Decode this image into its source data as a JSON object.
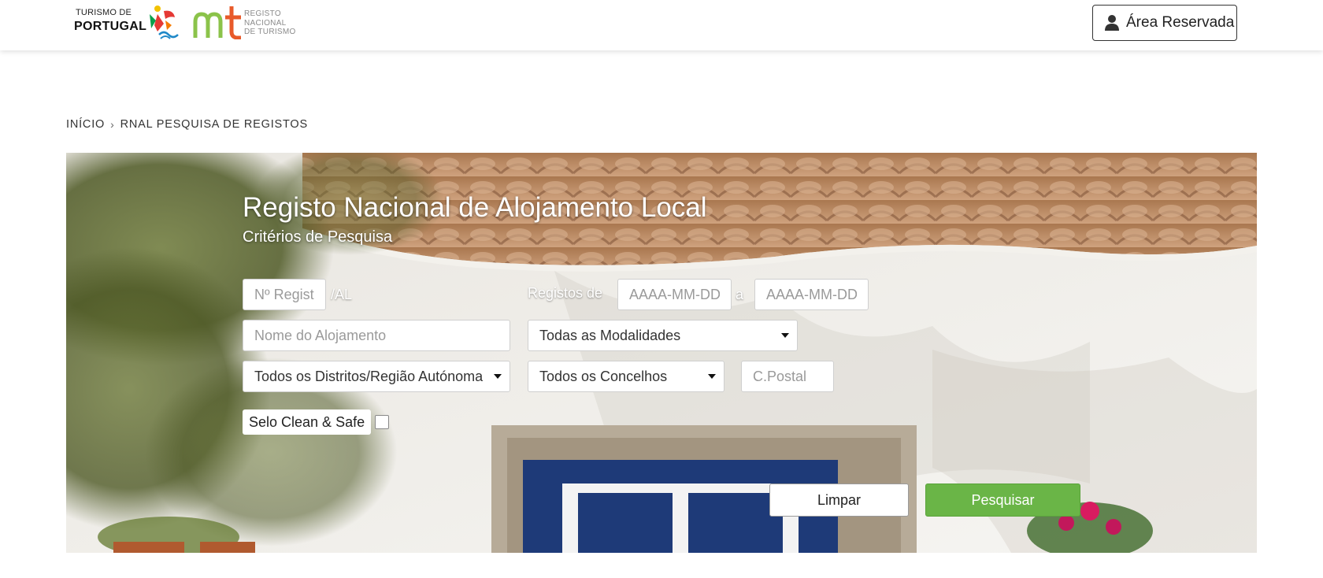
{
  "header": {
    "logo_tp_top": "TURISMO DE",
    "logo_tp_bottom": "PORTUGAL",
    "logo_rnt_line1": "REGISTO",
    "logo_rnt_line2": "NACIONAL",
    "logo_rnt_line3": "DE TURISMO",
    "area_reservada_label": "Área Reservada"
  },
  "breadcrumb": {
    "home": "INÍCIO",
    "separator": "›",
    "current": "RNAL PESQUISA DE REGISTOS"
  },
  "search": {
    "title": "Registo Nacional de Alojamento Local",
    "subtitle": "Critérios de Pesquisa",
    "registo_placeholder": "Nº Registo",
    "registo_suffix": "/AL",
    "registos_de_label": "Registos de",
    "date_from_placeholder": "AAAA-MM-DD",
    "date_sep": "a",
    "date_to_placeholder": "AAAA-MM-DD",
    "nome_placeholder": "Nome do Alojamento",
    "modalidades_value": "Todas as Modalidades",
    "distritos_value": "Todos os Distritos/Região Autónoma",
    "concelhos_value": "Todos os Concelhos",
    "cpostal_placeholder": "C.Postal",
    "clean_safe_label": "Selo Clean & Safe",
    "limpar_label": "Limpar",
    "pesquisar_label": "Pesquisar"
  },
  "colors": {
    "accent_green": "#6ab547",
    "text_dark": "#222222"
  },
  "icons": {
    "user": "user-icon",
    "caret": "caret-down-icon",
    "breadcrumb_sep": "chevron-right-icon"
  }
}
